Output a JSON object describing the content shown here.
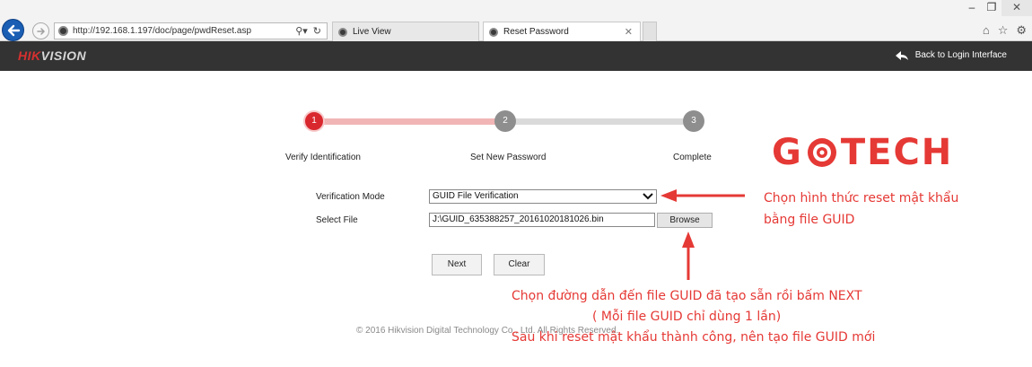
{
  "browser": {
    "url": "http://192.168.1.197/doc/page/pwdReset.asp",
    "tabs": [
      {
        "label": "Live View",
        "active": false
      },
      {
        "label": "Reset Password",
        "active": true
      }
    ]
  },
  "header": {
    "logo_primary": "HIK",
    "logo_secondary": "VISION",
    "back_link": "Back to Login Interface"
  },
  "steps": [
    {
      "number": "1",
      "label": "Verify Identification",
      "active": true
    },
    {
      "number": "2",
      "label": "Set New Password",
      "active": false
    },
    {
      "number": "3",
      "label": "Complete",
      "active": false
    }
  ],
  "form": {
    "mode_label": "Verification Mode",
    "mode_value": "GUID File Verification",
    "file_label": "Select File",
    "file_value": "J:\\GUID_635388257_20161020181026.bin",
    "browse_label": "Browse",
    "next_label": "Next",
    "clear_label": "Clear"
  },
  "footer": {
    "copyright": "© 2016 Hikvision Digital Technology Co., Ltd. All Rights Reserved."
  },
  "annotations": {
    "brand_left": "G",
    "brand_right": "TECH",
    "note_mode_line1": "Chọn hình thức reset mật khẩu",
    "note_mode_line2": "bằng file GUID",
    "note_file_line1": "Chọn đường dẫn đến file GUID đã tạo sẵn rồi bấm NEXT",
    "note_file_line2": "( Mỗi file GUID chỉ dùng 1 lần)",
    "note_file_line3": "Sau khi reset mật khẩu thành công, nên tạo file GUID mới"
  },
  "colors": {
    "accent_red": "#d9272e",
    "annotation_red": "#e53935",
    "header_bg": "#333333"
  },
  "icons": {
    "back": "back-arrow-icon",
    "forward": "forward-arrow-icon",
    "search": "search-icon",
    "refresh": "refresh-icon",
    "home": "home-icon",
    "favorites": "star-icon",
    "settings": "gear-icon",
    "back_login": "reply-arrow-icon"
  }
}
